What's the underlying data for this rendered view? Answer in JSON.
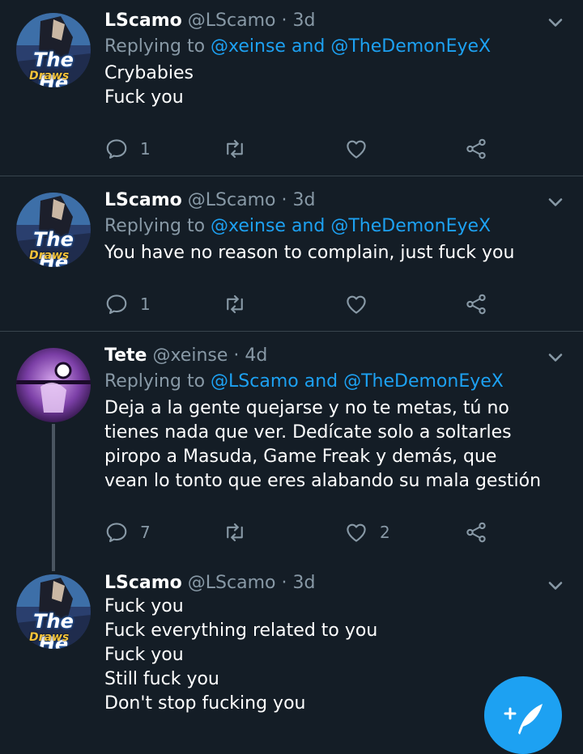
{
  "tweets": [
    {
      "name": "LScamo",
      "handle": "@LScamo",
      "dot": "·",
      "time": "3d",
      "reply_prefix": "Replying to",
      "reply_mentions": "@xeinse and @TheDemonEyeX",
      "lines": [
        "Crybabies",
        "Fuck you"
      ],
      "reply_count": "1",
      "retweet_count": "",
      "like_count": ""
    },
    {
      "name": "LScamo",
      "handle": "@LScamo",
      "dot": "·",
      "time": "3d",
      "reply_prefix": "Replying to",
      "reply_mentions": "@xeinse and @TheDemonEyeX",
      "lines": [
        "You have no reason to complain, just fuck you"
      ],
      "reply_count": "1",
      "retweet_count": "",
      "like_count": ""
    },
    {
      "name": "Tete",
      "handle": "@xeinse",
      "dot": "·",
      "time": "4d",
      "reply_prefix": "Replying to",
      "reply_mentions": "@LScamo and @TheDemonEyeX",
      "lines": [
        "Deja a la gente quejarse y no te metas, tú no tienes nada que ver. Dedícate solo a soltarles piropo a Masuda, Game Freak y demás, que vean lo tonto que eres alabando su mala gestión"
      ],
      "reply_count": "7",
      "retweet_count": "",
      "like_count": "2"
    },
    {
      "name": "LScamo",
      "handle": "@LScamo",
      "dot": "·",
      "time": "3d",
      "lines": [
        "Fuck you",
        "Fuck everything related to you",
        "Fuck you",
        "Still fuck you",
        "Don't stop fucking you"
      ]
    }
  ],
  "avatar_logo": {
    "line1": "The He",
    "line2": "Draws"
  },
  "icons": {
    "reply": "reply-icon",
    "retweet": "retweet-icon",
    "like": "heart-icon",
    "share": "share-icon",
    "menu": "chevron-down-icon",
    "compose": "compose-icon"
  },
  "colors": {
    "background": "#141d26",
    "accent": "#1da1f2",
    "muted": "#8899a6",
    "divider": "#38444d"
  }
}
